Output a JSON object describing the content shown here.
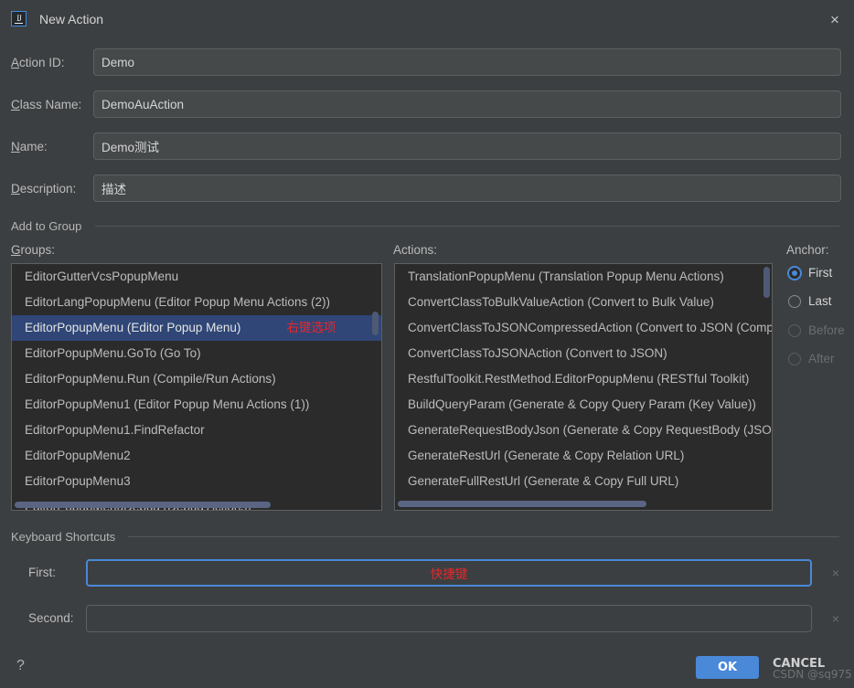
{
  "window": {
    "title": "New Action",
    "icon": "intellij-idea-icon",
    "close_label": "×"
  },
  "form": {
    "fields": [
      {
        "label_prefix": "",
        "label_mnemonic": "A",
        "label_rest": "ction ID:",
        "value": "Demo",
        "name": "action-id"
      },
      {
        "label_prefix": "",
        "label_mnemonic": "C",
        "label_rest": "lass Name:",
        "value": "DemoAuAction",
        "name": "class-name"
      },
      {
        "label_prefix": "",
        "label_mnemonic": "N",
        "label_rest": "ame:",
        "value": "Demo测试",
        "name": "name"
      },
      {
        "label_prefix": "",
        "label_mnemonic": "D",
        "label_rest": "escription:",
        "value": "描述",
        "name": "description"
      }
    ]
  },
  "add_to_group": {
    "section_title": "Add to Group",
    "groups_label_mnemonic": "G",
    "groups_label_rest": "roups:",
    "actions_label": "Actions:",
    "anchor_label": "Anchor:",
    "groups": [
      {
        "text": "EditorGutterVcsPopupMenu",
        "selected": false
      },
      {
        "text": "EditorLangPopupMenu (Editor Popup Menu Actions (2))",
        "selected": false
      },
      {
        "text": "EditorPopupMenu (Editor Popup Menu)",
        "selected": true,
        "annotation": "右键选项"
      },
      {
        "text": "EditorPopupMenu.GoTo (Go To)",
        "selected": false
      },
      {
        "text": "EditorPopupMenu.Run (Compile/Run Actions)",
        "selected": false
      },
      {
        "text": "EditorPopupMenu1 (Editor Popup Menu Actions (1))",
        "selected": false
      },
      {
        "text": "EditorPopupMenu1.FindRefactor",
        "selected": false
      },
      {
        "text": "EditorPopupMenu2",
        "selected": false
      },
      {
        "text": "EditorPopupMenu3",
        "selected": false
      },
      {
        "text": "EditorPopupMenuDebug (Debug Actions)",
        "selected": false
      }
    ],
    "actions": [
      "TranslationPopupMenu (Translation Popup Menu Actions)",
      "ConvertClassToBulkValueAction (Convert to Bulk Value)",
      "ConvertClassToJSONCompressedAction (Convert to JSON (Compres",
      "ConvertClassToJSONAction (Convert to JSON)",
      "RestfulToolkit.RestMethod.EditorPopupMenu (RESTful Toolkit)",
      "BuildQueryParam (Generate & Copy Query Param (Key Value))",
      "GenerateRequestBodyJson (Generate & Copy RequestBody (JSON))",
      "GenerateRestUrl (Generate & Copy Relation URL)",
      "GenerateFullRestUrl (Generate & Copy Full URL)"
    ],
    "anchor_options": [
      {
        "label": "First",
        "checked": true,
        "disabled": false
      },
      {
        "label": "Last",
        "checked": false,
        "disabled": false
      },
      {
        "label": "Before",
        "checked": false,
        "disabled": true
      },
      {
        "label": "After",
        "checked": false,
        "disabled": true
      }
    ]
  },
  "keyboard_shortcuts": {
    "section_title": "Keyboard Shortcuts",
    "first_label": "First:",
    "first_value": "快捷键",
    "second_label": "Second:",
    "second_value": "",
    "clear_icon": "×"
  },
  "footer": {
    "help_label": "?",
    "ok_label": "OK",
    "cancel_label": "CANCEL",
    "watermark": "CSDN @sq975"
  },
  "colors": {
    "dialog_bg": "#3c3f41",
    "list_bg": "#2b2b2b",
    "selection_blue": "#2f4676",
    "accent_blue": "#4a88d8",
    "annotation_red": "#e8272c"
  }
}
